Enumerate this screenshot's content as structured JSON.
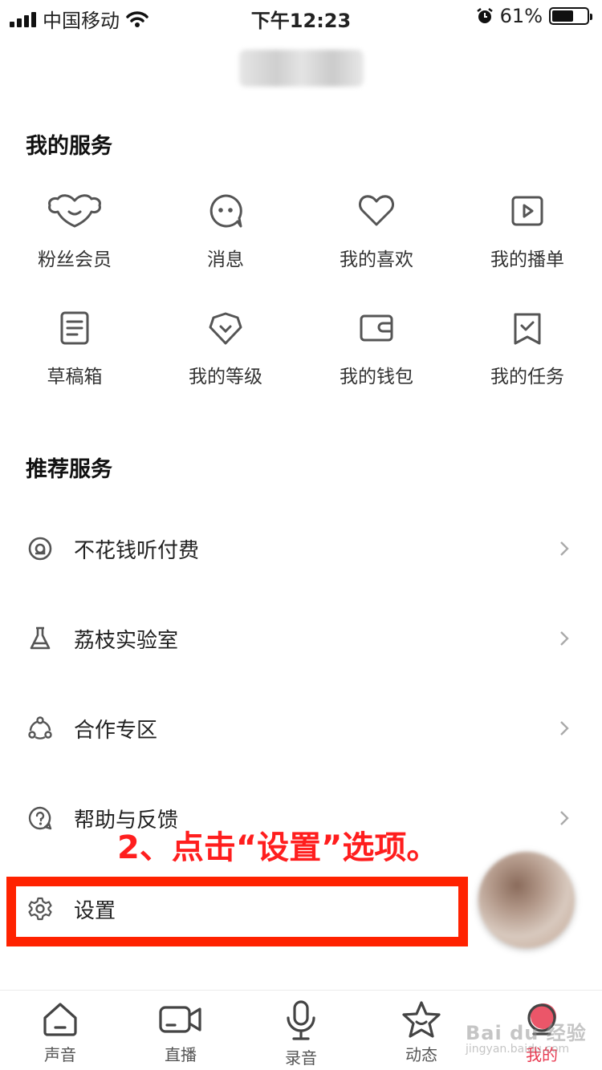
{
  "status_bar": {
    "carrier": "中国移动",
    "time": "下午12:23",
    "battery": "61%",
    "battery_level": 0.61
  },
  "my_services": {
    "title": "我的服务",
    "items": [
      {
        "label": "粉丝会员",
        "icon": "fan-member-icon"
      },
      {
        "label": "消息",
        "icon": "message-icon"
      },
      {
        "label": "我的喜欢",
        "icon": "heart-icon"
      },
      {
        "label": "我的播单",
        "icon": "playlist-icon"
      },
      {
        "label": "草稿箱",
        "icon": "draft-icon"
      },
      {
        "label": "我的等级",
        "icon": "level-icon"
      },
      {
        "label": "我的钱包",
        "icon": "wallet-icon"
      },
      {
        "label": "我的任务",
        "icon": "task-icon"
      }
    ]
  },
  "recommended": {
    "title": "推荐服务",
    "items": [
      {
        "label": "不花钱听付费",
        "icon": "disc-icon"
      },
      {
        "label": "荔枝实验室",
        "icon": "flask-icon"
      },
      {
        "label": "合作专区",
        "icon": "cooperation-icon"
      },
      {
        "label": "帮助与反馈",
        "icon": "help-icon"
      },
      {
        "label": "设置",
        "icon": "gear-icon"
      }
    ]
  },
  "annotation": "2、点击“设置”选项。",
  "tabs": [
    {
      "label": "声音",
      "icon": "home-icon"
    },
    {
      "label": "直播",
      "icon": "camera-icon"
    },
    {
      "label": "录音",
      "icon": "microphone-icon"
    },
    {
      "label": "动态",
      "icon": "star-icon"
    },
    {
      "label": "我的",
      "icon": "profile-icon",
      "active": true
    }
  ],
  "watermark": {
    "text": "Bai du 经验",
    "sub": "jingyan.baidu.com"
  },
  "colors": {
    "accent": "#e8384f",
    "annotation": "#ff1e1e",
    "highlight": "#ff2200"
  }
}
